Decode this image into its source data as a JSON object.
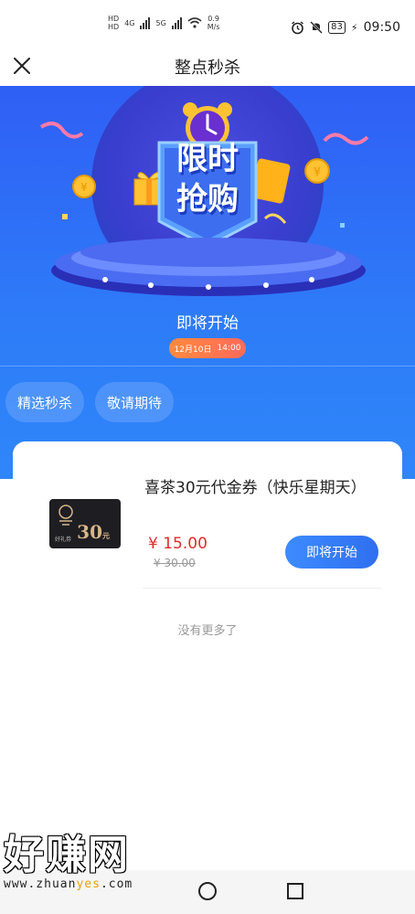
{
  "status_bar": {
    "net_speed": "0.9",
    "net_unit": "M/s",
    "battery": "83",
    "time": "09:50",
    "network_left": "4G",
    "network_right": "5G"
  },
  "nav": {
    "title": "整点秒杀"
  },
  "hero": {
    "badge_text_top": "限时",
    "badge_text_bottom": "抢购",
    "status_text": "即将开始",
    "time_date": "12月10日",
    "time_clock": "14:00",
    "tabs": [
      {
        "label": "精选秒杀"
      },
      {
        "label": "敬请期待"
      }
    ]
  },
  "product": {
    "name": "喜茶30元代金券（快乐星期天）",
    "price": "¥ 15.00",
    "original_price": "¥ 30.00",
    "button_label": "即将开始",
    "thumb_value": "30",
    "thumb_unit": "元",
    "thumb_label": "好礼券"
  },
  "list_footer": "没有更多了",
  "watermark": {
    "big": "好赚网",
    "small_pre": "www.zhuan",
    "small_hl": "yes",
    "small_post": ".com"
  },
  "colors": {
    "hero_top": "#2f5ff5",
    "hero_bottom": "#2f86f9",
    "price": "#e22b2b",
    "button": "#3d8bff",
    "pill": "#ff7a4a"
  }
}
